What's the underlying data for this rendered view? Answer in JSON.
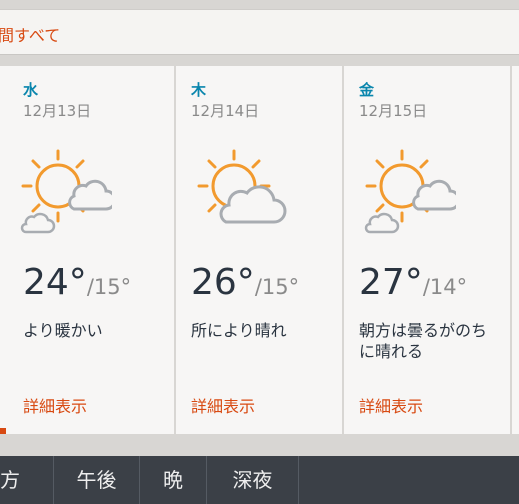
{
  "filter": {
    "label": "間すべて"
  },
  "cards": [
    {
      "day": "水",
      "date": "12月13日",
      "icon": "sun-behind-cloud-with-small-cloud-icon",
      "hi": "24°",
      "lo": "/15°",
      "cond": "より暖かい",
      "detail": "詳細表示"
    },
    {
      "day": "木",
      "date": "12月14日",
      "icon": "sun-behind-cloud-icon",
      "hi": "26°",
      "lo": "/15°",
      "cond": "所により晴れ",
      "detail": "詳細表示"
    },
    {
      "day": "金",
      "date": "12月15日",
      "icon": "sun-behind-cloud-with-small-cloud-icon",
      "hi": "27°",
      "lo": "/14°",
      "cond": "朝方は曇るがのちに晴れる",
      "detail": "詳細表示"
    }
  ],
  "tabs": [
    {
      "label": "方"
    },
    {
      "label": "午後"
    },
    {
      "label": "晩"
    },
    {
      "label": "深夜"
    }
  ],
  "colors": {
    "accent": "#d84a12",
    "day": "#0a86ad",
    "sun": "#f29a2e",
    "cloud": "#a8acb1",
    "tabbar": "#3b4047"
  }
}
